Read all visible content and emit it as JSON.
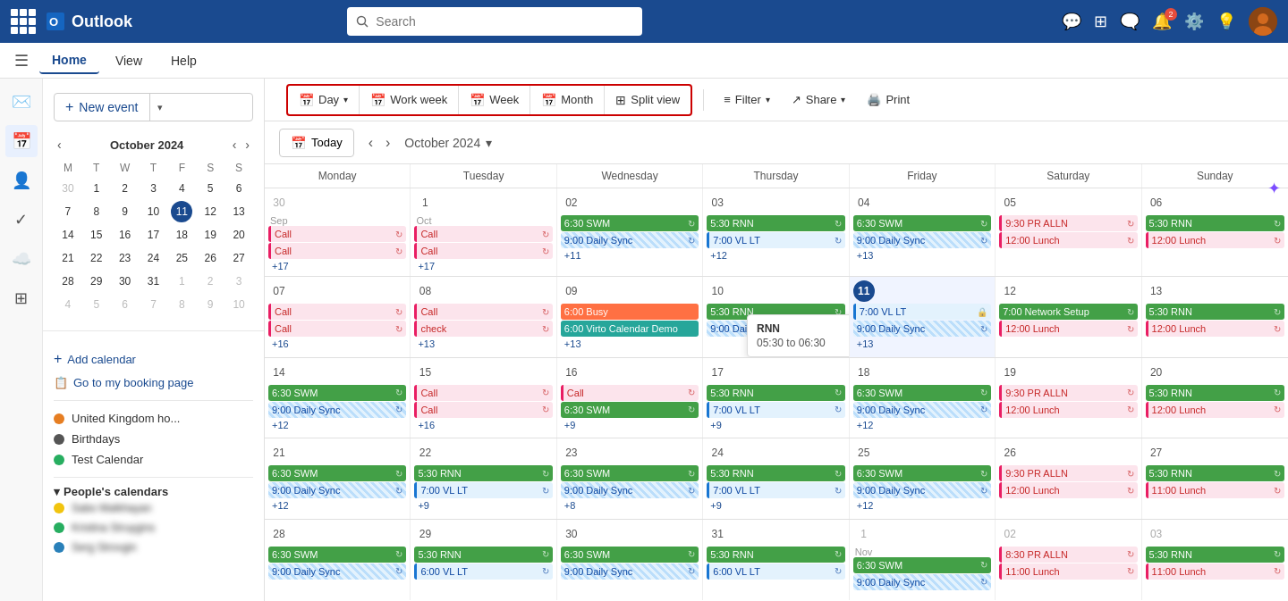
{
  "topbar": {
    "app_name": "Outlook",
    "search_placeholder": "Search",
    "notification_count": "2"
  },
  "nav": {
    "tabs": [
      "Home",
      "View",
      "Help"
    ],
    "active": "Home"
  },
  "toolbar": {
    "new_event_label": "New event",
    "view_buttons": [
      "Day",
      "Work week",
      "Week",
      "Month",
      "Split view"
    ],
    "filter_label": "Filter",
    "share_label": "Share",
    "print_label": "Print"
  },
  "calendar_nav": {
    "today_label": "Today",
    "month_title": "October 2024",
    "chevron": "▾"
  },
  "day_headers": [
    "Monday",
    "Tuesday",
    "Wednesday",
    "Thursday",
    "Friday",
    "Saturday",
    "Sunday"
  ],
  "mini_cal": {
    "title": "October 2024",
    "day_headers": [
      "M",
      "T",
      "W",
      "T",
      "F",
      "S",
      "S"
    ],
    "weeks": [
      [
        {
          "n": "30",
          "other": true
        },
        {
          "n": "1"
        },
        {
          "n": "2"
        },
        {
          "n": "3"
        },
        {
          "n": "4"
        },
        {
          "n": "5"
        },
        {
          "n": "6"
        }
      ],
      [
        {
          "n": "7"
        },
        {
          "n": "8"
        },
        {
          "n": "9"
        },
        {
          "n": "10"
        },
        {
          "n": "11",
          "today": true
        },
        {
          "n": "12"
        },
        {
          "n": "13"
        }
      ],
      [
        {
          "n": "14"
        },
        {
          "n": "15"
        },
        {
          "n": "16"
        },
        {
          "n": "17"
        },
        {
          "n": "18"
        },
        {
          "n": "19"
        },
        {
          "n": "20"
        }
      ],
      [
        {
          "n": "21"
        },
        {
          "n": "22"
        },
        {
          "n": "23"
        },
        {
          "n": "24"
        },
        {
          "n": "25"
        },
        {
          "n": "26"
        },
        {
          "n": "27"
        }
      ],
      [
        {
          "n": "28"
        },
        {
          "n": "29"
        },
        {
          "n": "30"
        },
        {
          "n": "31"
        },
        {
          "n": "1",
          "other": true
        },
        {
          "n": "2",
          "other": true
        },
        {
          "n": "3",
          "other": true
        }
      ],
      [
        {
          "n": "4",
          "other": true
        },
        {
          "n": "5",
          "other": true
        },
        {
          "n": "6",
          "other": true
        },
        {
          "n": "7",
          "other": true
        },
        {
          "n": "8",
          "other": true
        },
        {
          "n": "9",
          "other": true
        },
        {
          "n": "10",
          "other": true
        }
      ]
    ]
  },
  "calendars": {
    "add_label": "Add calendar",
    "booking_label": "Go to my booking page",
    "my_calendars": [
      {
        "name": "United Kingdom ho...",
        "color": "#e67e22"
      },
      {
        "name": "Birthdays",
        "color": "#555"
      },
      {
        "name": "Test Calendar",
        "color": "#27ae60"
      }
    ],
    "peoples_calendars_title": "People's calendars",
    "peoples": [
      {
        "name": "Sabo Malkhayan",
        "color": "#f1c40f"
      },
      {
        "name": "Kristina Struygins",
        "color": "#27ae60"
      },
      {
        "name": "Serg Strovgin",
        "color": "#2980b9"
      }
    ]
  },
  "weeks": [
    {
      "dates": [
        "30 Sep",
        "1 Oct",
        "02",
        "03",
        "04",
        "05",
        "06"
      ],
      "days": [
        {
          "num": "30",
          "month_other": true,
          "events": [
            {
              "label": "Call",
              "type": "pink",
              "icon": "↻"
            },
            {
              "label": "Call",
              "type": "pink",
              "icon": "↻"
            }
          ],
          "more": "+17"
        },
        {
          "num": "1",
          "events": [
            {
              "label": "Call",
              "type": "pink",
              "icon": "↻"
            },
            {
              "label": "Call",
              "type": "pink",
              "icon": "↻"
            }
          ],
          "more": "+17"
        },
        {
          "num": "02",
          "events": [
            {
              "label": "6:30 SWM",
              "type": "green-solid",
              "icon": "↻"
            },
            {
              "label": "9:00 Daily Sync",
              "type": "blue-stripe",
              "icon": "↻"
            }
          ],
          "more": "+11"
        },
        {
          "num": "03",
          "events": [
            {
              "label": "5:30 RNN",
              "type": "green-solid",
              "icon": "↻"
            },
            {
              "label": "7:00 VL LT",
              "type": "blue",
              "icon": "↻"
            }
          ],
          "more": "+12"
        },
        {
          "num": "04",
          "events": [
            {
              "label": "6:30 SWM",
              "type": "green-solid",
              "icon": "↻"
            },
            {
              "label": "9:00 Daily Sync",
              "type": "blue-stripe",
              "icon": "↻"
            }
          ],
          "more": "+13"
        },
        {
          "num": "05",
          "events": [
            {
              "label": "9:30 PR ALLN",
              "type": "pink",
              "icon": "↻"
            },
            {
              "label": "12:00 Lunch",
              "type": "pink",
              "icon": "↻"
            }
          ],
          "more": ""
        },
        {
          "num": "06",
          "events": [
            {
              "label": "5:30 RNN",
              "type": "green-solid",
              "icon": "↻"
            },
            {
              "label": "12:00 Lunch",
              "type": "pink",
              "icon": "↻"
            }
          ],
          "more": ""
        }
      ]
    },
    {
      "dates": [
        "07",
        "08",
        "09",
        "10",
        "11",
        "12",
        "13"
      ],
      "days": [
        {
          "num": "07",
          "events": [
            {
              "label": "Call",
              "type": "pink",
              "icon": "↻"
            },
            {
              "label": "Call",
              "type": "pink",
              "icon": "↻"
            }
          ],
          "more": "+16"
        },
        {
          "num": "08",
          "events": [
            {
              "label": "Call",
              "type": "pink",
              "icon": "↻"
            },
            {
              "label": "check",
              "type": "pink",
              "icon": "↻"
            }
          ],
          "more": "+13"
        },
        {
          "num": "09",
          "events": [
            {
              "label": "6:00 Busy",
              "type": "orange",
              "icon": ""
            },
            {
              "label": "6:00 Virto Calendar Demo",
              "type": "teal",
              "icon": ""
            }
          ],
          "more": "+13"
        },
        {
          "num": "10",
          "events": [
            {
              "label": "5:30 RNN",
              "type": "green-solid",
              "icon": "↻"
            },
            {
              "label": "9:00 Daily Sync",
              "type": "blue-stripe",
              "icon": "↻"
            }
          ],
          "more": "",
          "tooltip": {
            "title": "RNN",
            "time": "05:30 to 06:30"
          }
        },
        {
          "num": "11",
          "today": true,
          "events": [
            {
              "label": "7:00 VL LT",
              "type": "blue",
              "icon": "🔒"
            },
            {
              "label": "9:00 Daily Sync",
              "type": "blue-stripe",
              "icon": "↻"
            }
          ],
          "more": "+13"
        },
        {
          "num": "12",
          "events": [
            {
              "label": "7:00 Network Setup",
              "type": "green-solid",
              "icon": "↻"
            },
            {
              "label": "12:00 Lunch",
              "type": "pink",
              "icon": "↻"
            }
          ],
          "more": ""
        },
        {
          "num": "13",
          "events": [
            {
              "label": "5:30 RNN",
              "type": "green-solid",
              "icon": "↻"
            },
            {
              "label": "12:00 Lunch",
              "type": "pink",
              "icon": "↻"
            }
          ],
          "more": ""
        }
      ]
    },
    {
      "dates": [
        "14",
        "15",
        "16",
        "17",
        "18",
        "19",
        "20"
      ],
      "days": [
        {
          "num": "14",
          "events": [
            {
              "label": "6:30 SWM",
              "type": "green-solid",
              "icon": "↻"
            },
            {
              "label": "9:00 Daily Sync",
              "type": "blue-stripe",
              "icon": "↻"
            }
          ],
          "more": "+12"
        },
        {
          "num": "15",
          "events": [
            {
              "label": "Call",
              "type": "pink",
              "icon": "↻"
            },
            {
              "label": "Call",
              "type": "pink",
              "icon": "↻"
            }
          ],
          "more": "+16"
        },
        {
          "num": "16",
          "events": [
            {
              "label": "Call",
              "type": "pink",
              "icon": "↻"
            },
            {
              "label": "6:30 SWM",
              "type": "green-solid",
              "icon": "↻"
            }
          ],
          "more": "+9"
        },
        {
          "num": "17",
          "events": [
            {
              "label": "5:30 RNN",
              "type": "green-solid",
              "icon": "↻"
            },
            {
              "label": "7:00 VL LT",
              "type": "blue",
              "icon": "↻"
            }
          ],
          "more": "+9"
        },
        {
          "num": "18",
          "events": [
            {
              "label": "6:30 SWM",
              "type": "green-solid",
              "icon": "↻"
            },
            {
              "label": "9:00 Daily Sync",
              "type": "blue-stripe",
              "icon": "↻"
            }
          ],
          "more": "+12"
        },
        {
          "num": "19",
          "events": [
            {
              "label": "9:30 PR ALLN",
              "type": "pink",
              "icon": "↻"
            },
            {
              "label": "12:00 Lunch",
              "type": "pink",
              "icon": "↻"
            }
          ],
          "more": ""
        },
        {
          "num": "20",
          "events": [
            {
              "label": "5:30 RNN",
              "type": "green-solid",
              "icon": "↻"
            },
            {
              "label": "12:00 Lunch",
              "type": "pink",
              "icon": "↻"
            }
          ],
          "more": ""
        }
      ]
    },
    {
      "dates": [
        "21",
        "22",
        "23",
        "24",
        "25",
        "26",
        "27"
      ],
      "days": [
        {
          "num": "21",
          "events": [
            {
              "label": "6:30 SWM",
              "type": "green-solid",
              "icon": "↻"
            },
            {
              "label": "9:00 Daily Sync",
              "type": "blue-stripe",
              "icon": "↻"
            }
          ],
          "more": "+12"
        },
        {
          "num": "22",
          "events": [
            {
              "label": "5:30 RNN",
              "type": "green-solid",
              "icon": "↻"
            },
            {
              "label": "7:00 VL LT",
              "type": "blue",
              "icon": "↻"
            }
          ],
          "more": "+9"
        },
        {
          "num": "23",
          "events": [
            {
              "label": "6:30 SWM",
              "type": "green-solid",
              "icon": "↻"
            },
            {
              "label": "9:00 Daily Sync",
              "type": "blue-stripe",
              "icon": "↻"
            }
          ],
          "more": "+8"
        },
        {
          "num": "24",
          "events": [
            {
              "label": "5:30 RNN",
              "type": "green-solid",
              "icon": "↻"
            },
            {
              "label": "7:00 VL LT",
              "type": "blue",
              "icon": "↻"
            }
          ],
          "more": "+9"
        },
        {
          "num": "25",
          "events": [
            {
              "label": "6:30 SWM",
              "type": "green-solid",
              "icon": "↻"
            },
            {
              "label": "9:00 Daily Sync",
              "type": "blue-stripe",
              "icon": "↻"
            }
          ],
          "more": "+12"
        },
        {
          "num": "26",
          "events": [
            {
              "label": "9:30 PR ALLN",
              "type": "pink",
              "icon": "↻"
            },
            {
              "label": "12:00 Lunch",
              "type": "pink",
              "icon": "↻"
            }
          ],
          "more": ""
        },
        {
          "num": "27",
          "events": [
            {
              "label": "5:30 RNN",
              "type": "green-solid",
              "icon": "↻"
            },
            {
              "label": "11:00 Lunch",
              "type": "pink",
              "icon": "↻"
            }
          ],
          "more": ""
        }
      ]
    },
    {
      "dates": [
        "28",
        "29",
        "30",
        "31",
        "1 Nov",
        "02",
        "03"
      ],
      "days": [
        {
          "num": "28",
          "events": [
            {
              "label": "6:30 SWM",
              "type": "green-solid",
              "icon": "↻"
            },
            {
              "label": "9:00 Daily Sync",
              "type": "blue-stripe",
              "icon": "↻"
            }
          ],
          "more": ""
        },
        {
          "num": "29",
          "events": [
            {
              "label": "5:30 RNN",
              "type": "green-solid",
              "icon": "↻"
            },
            {
              "label": "6:00 VL LT",
              "type": "blue",
              "icon": "↻"
            }
          ],
          "more": ""
        },
        {
          "num": "30",
          "events": [
            {
              "label": "6:30 SWM",
              "type": "green-solid",
              "icon": "↻"
            },
            {
              "label": "9:00 Daily Sync",
              "type": "blue-stripe",
              "icon": "↻"
            }
          ],
          "more": ""
        },
        {
          "num": "31",
          "events": [
            {
              "label": "5:30 RNN",
              "type": "green-solid",
              "icon": "↻"
            },
            {
              "label": "6:00 VL LT",
              "type": "blue",
              "icon": "↻"
            }
          ],
          "more": ""
        },
        {
          "num": "1",
          "month_other": true,
          "events": [
            {
              "label": "6:30 SWM",
              "type": "green-solid",
              "icon": "↻"
            },
            {
              "label": "9:00 Daily Sync",
              "type": "blue-stripe",
              "icon": "↻"
            }
          ],
          "more": ""
        },
        {
          "num": "02",
          "month_other": true,
          "events": [
            {
              "label": "8:30 PR ALLN",
              "type": "pink",
              "icon": "↻"
            },
            {
              "label": "11:00 Lunch",
              "type": "pink",
              "icon": "↻"
            }
          ],
          "more": ""
        },
        {
          "num": "03",
          "month_other": true,
          "events": [
            {
              "label": "5:30 RNN",
              "type": "green-solid",
              "icon": "↻"
            },
            {
              "label": "11:00 Lunch",
              "type": "pink",
              "icon": "↻"
            }
          ],
          "more": ""
        }
      ]
    }
  ]
}
